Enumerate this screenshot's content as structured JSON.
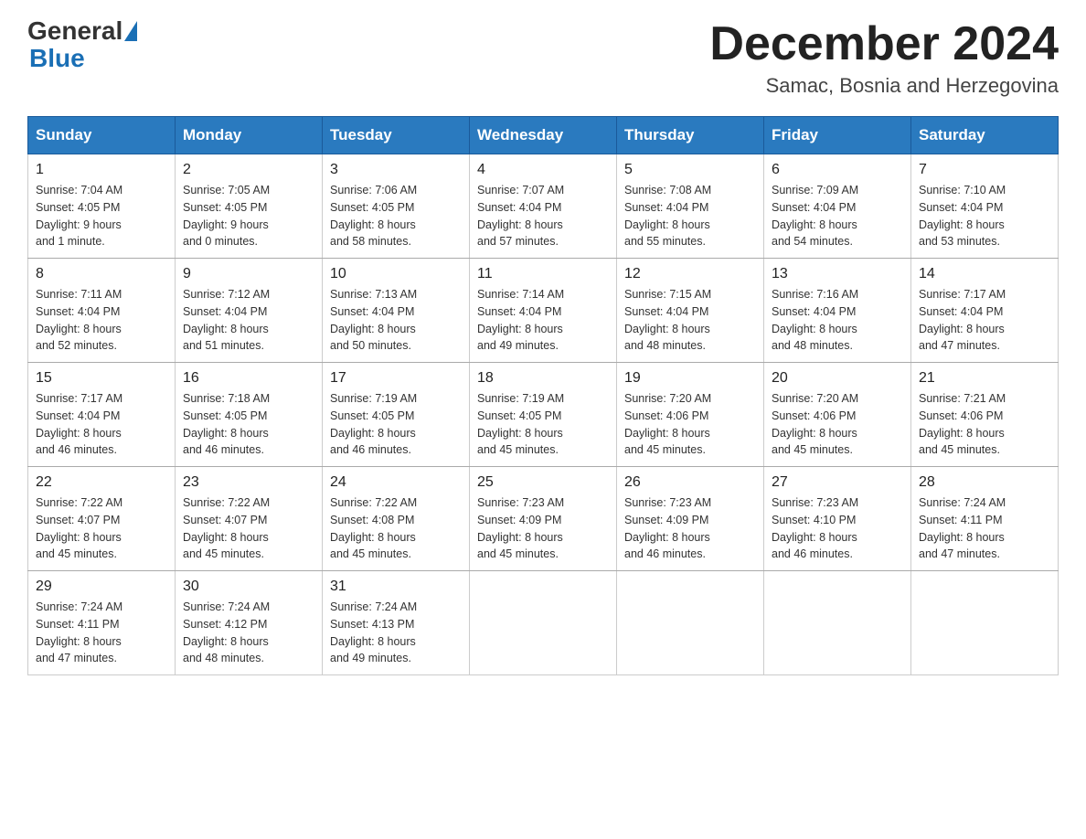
{
  "header": {
    "logo_general": "General",
    "logo_blue": "Blue",
    "month_year": "December 2024",
    "location": "Samac, Bosnia and Herzegovina"
  },
  "days_of_week": [
    "Sunday",
    "Monday",
    "Tuesday",
    "Wednesday",
    "Thursday",
    "Friday",
    "Saturday"
  ],
  "weeks": [
    [
      {
        "day": "1",
        "sunrise": "Sunrise: 7:04 AM",
        "sunset": "Sunset: 4:05 PM",
        "daylight": "Daylight: 9 hours",
        "daylight2": "and 1 minute."
      },
      {
        "day": "2",
        "sunrise": "Sunrise: 7:05 AM",
        "sunset": "Sunset: 4:05 PM",
        "daylight": "Daylight: 9 hours",
        "daylight2": "and 0 minutes."
      },
      {
        "day": "3",
        "sunrise": "Sunrise: 7:06 AM",
        "sunset": "Sunset: 4:05 PM",
        "daylight": "Daylight: 8 hours",
        "daylight2": "and 58 minutes."
      },
      {
        "day": "4",
        "sunrise": "Sunrise: 7:07 AM",
        "sunset": "Sunset: 4:04 PM",
        "daylight": "Daylight: 8 hours",
        "daylight2": "and 57 minutes."
      },
      {
        "day": "5",
        "sunrise": "Sunrise: 7:08 AM",
        "sunset": "Sunset: 4:04 PM",
        "daylight": "Daylight: 8 hours",
        "daylight2": "and 55 minutes."
      },
      {
        "day": "6",
        "sunrise": "Sunrise: 7:09 AM",
        "sunset": "Sunset: 4:04 PM",
        "daylight": "Daylight: 8 hours",
        "daylight2": "and 54 minutes."
      },
      {
        "day": "7",
        "sunrise": "Sunrise: 7:10 AM",
        "sunset": "Sunset: 4:04 PM",
        "daylight": "Daylight: 8 hours",
        "daylight2": "and 53 minutes."
      }
    ],
    [
      {
        "day": "8",
        "sunrise": "Sunrise: 7:11 AM",
        "sunset": "Sunset: 4:04 PM",
        "daylight": "Daylight: 8 hours",
        "daylight2": "and 52 minutes."
      },
      {
        "day": "9",
        "sunrise": "Sunrise: 7:12 AM",
        "sunset": "Sunset: 4:04 PM",
        "daylight": "Daylight: 8 hours",
        "daylight2": "and 51 minutes."
      },
      {
        "day": "10",
        "sunrise": "Sunrise: 7:13 AM",
        "sunset": "Sunset: 4:04 PM",
        "daylight": "Daylight: 8 hours",
        "daylight2": "and 50 minutes."
      },
      {
        "day": "11",
        "sunrise": "Sunrise: 7:14 AM",
        "sunset": "Sunset: 4:04 PM",
        "daylight": "Daylight: 8 hours",
        "daylight2": "and 49 minutes."
      },
      {
        "day": "12",
        "sunrise": "Sunrise: 7:15 AM",
        "sunset": "Sunset: 4:04 PM",
        "daylight": "Daylight: 8 hours",
        "daylight2": "and 48 minutes."
      },
      {
        "day": "13",
        "sunrise": "Sunrise: 7:16 AM",
        "sunset": "Sunset: 4:04 PM",
        "daylight": "Daylight: 8 hours",
        "daylight2": "and 48 minutes."
      },
      {
        "day": "14",
        "sunrise": "Sunrise: 7:17 AM",
        "sunset": "Sunset: 4:04 PM",
        "daylight": "Daylight: 8 hours",
        "daylight2": "and 47 minutes."
      }
    ],
    [
      {
        "day": "15",
        "sunrise": "Sunrise: 7:17 AM",
        "sunset": "Sunset: 4:04 PM",
        "daylight": "Daylight: 8 hours",
        "daylight2": "and 46 minutes."
      },
      {
        "day": "16",
        "sunrise": "Sunrise: 7:18 AM",
        "sunset": "Sunset: 4:05 PM",
        "daylight": "Daylight: 8 hours",
        "daylight2": "and 46 minutes."
      },
      {
        "day": "17",
        "sunrise": "Sunrise: 7:19 AM",
        "sunset": "Sunset: 4:05 PM",
        "daylight": "Daylight: 8 hours",
        "daylight2": "and 46 minutes."
      },
      {
        "day": "18",
        "sunrise": "Sunrise: 7:19 AM",
        "sunset": "Sunset: 4:05 PM",
        "daylight": "Daylight: 8 hours",
        "daylight2": "and 45 minutes."
      },
      {
        "day": "19",
        "sunrise": "Sunrise: 7:20 AM",
        "sunset": "Sunset: 4:06 PM",
        "daylight": "Daylight: 8 hours",
        "daylight2": "and 45 minutes."
      },
      {
        "day": "20",
        "sunrise": "Sunrise: 7:20 AM",
        "sunset": "Sunset: 4:06 PM",
        "daylight": "Daylight: 8 hours",
        "daylight2": "and 45 minutes."
      },
      {
        "day": "21",
        "sunrise": "Sunrise: 7:21 AM",
        "sunset": "Sunset: 4:06 PM",
        "daylight": "Daylight: 8 hours",
        "daylight2": "and 45 minutes."
      }
    ],
    [
      {
        "day": "22",
        "sunrise": "Sunrise: 7:22 AM",
        "sunset": "Sunset: 4:07 PM",
        "daylight": "Daylight: 8 hours",
        "daylight2": "and 45 minutes."
      },
      {
        "day": "23",
        "sunrise": "Sunrise: 7:22 AM",
        "sunset": "Sunset: 4:07 PM",
        "daylight": "Daylight: 8 hours",
        "daylight2": "and 45 minutes."
      },
      {
        "day": "24",
        "sunrise": "Sunrise: 7:22 AM",
        "sunset": "Sunset: 4:08 PM",
        "daylight": "Daylight: 8 hours",
        "daylight2": "and 45 minutes."
      },
      {
        "day": "25",
        "sunrise": "Sunrise: 7:23 AM",
        "sunset": "Sunset: 4:09 PM",
        "daylight": "Daylight: 8 hours",
        "daylight2": "and 45 minutes."
      },
      {
        "day": "26",
        "sunrise": "Sunrise: 7:23 AM",
        "sunset": "Sunset: 4:09 PM",
        "daylight": "Daylight: 8 hours",
        "daylight2": "and 46 minutes."
      },
      {
        "day": "27",
        "sunrise": "Sunrise: 7:23 AM",
        "sunset": "Sunset: 4:10 PM",
        "daylight": "Daylight: 8 hours",
        "daylight2": "and 46 minutes."
      },
      {
        "day": "28",
        "sunrise": "Sunrise: 7:24 AM",
        "sunset": "Sunset: 4:11 PM",
        "daylight": "Daylight: 8 hours",
        "daylight2": "and 47 minutes."
      }
    ],
    [
      {
        "day": "29",
        "sunrise": "Sunrise: 7:24 AM",
        "sunset": "Sunset: 4:11 PM",
        "daylight": "Daylight: 8 hours",
        "daylight2": "and 47 minutes."
      },
      {
        "day": "30",
        "sunrise": "Sunrise: 7:24 AM",
        "sunset": "Sunset: 4:12 PM",
        "daylight": "Daylight: 8 hours",
        "daylight2": "and 48 minutes."
      },
      {
        "day": "31",
        "sunrise": "Sunrise: 7:24 AM",
        "sunset": "Sunset: 4:13 PM",
        "daylight": "Daylight: 8 hours",
        "daylight2": "and 49 minutes."
      },
      null,
      null,
      null,
      null
    ]
  ]
}
